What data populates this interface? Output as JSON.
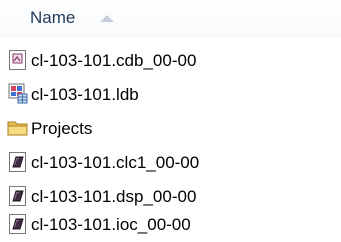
{
  "header": {
    "name_label": "Name"
  },
  "files": [
    {
      "name": "cl-103-101.cdb_00-00",
      "icon": "generic-file-icon"
    },
    {
      "name": "cl-103-101.ldb",
      "icon": "database-file-icon"
    },
    {
      "name": "Projects",
      "icon": "folder-icon"
    },
    {
      "name": "cl-103-101.clc1_00-00",
      "icon": "binary-file-icon"
    },
    {
      "name": "cl-103-101.dsp_00-00",
      "icon": "binary-file-icon"
    },
    {
      "name": "cl-103-101.ioc_00-00",
      "icon": "binary-file-icon"
    }
  ]
}
